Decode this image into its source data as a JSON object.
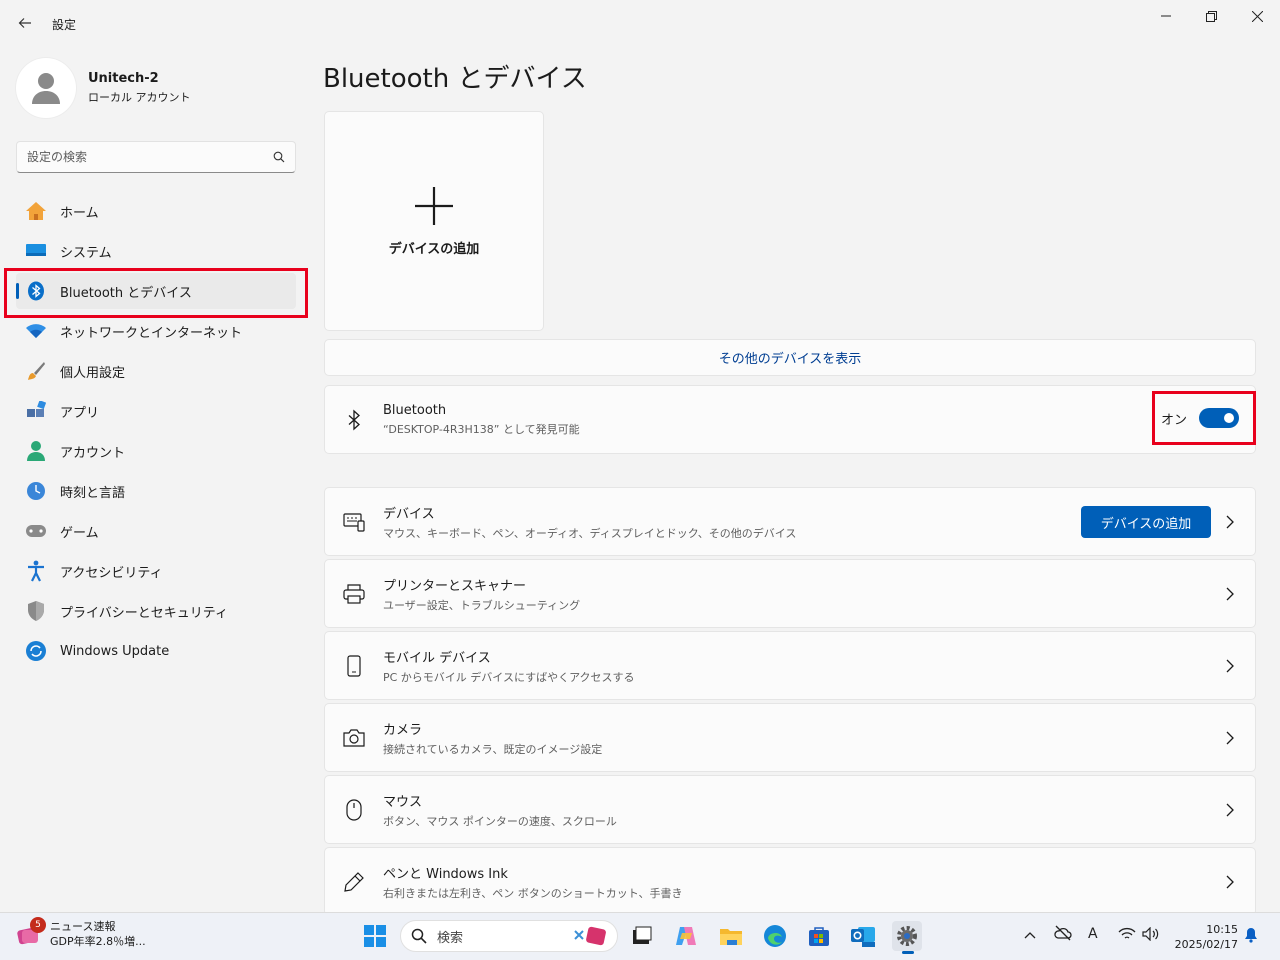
{
  "app": {
    "title": "設定"
  },
  "profile": {
    "name": "Unitech-2",
    "account_type": "ローカル アカウント"
  },
  "search": {
    "placeholder": "設定の検索"
  },
  "nav": {
    "items": [
      {
        "label": "ホーム",
        "icon": "home-icon"
      },
      {
        "label": "システム",
        "icon": "system-icon"
      },
      {
        "label": "Bluetooth とデバイス",
        "icon": "bluetooth-icon",
        "active": true
      },
      {
        "label": "ネットワークとインターネット",
        "icon": "wifi-icon"
      },
      {
        "label": "個人用設定",
        "icon": "brush-icon"
      },
      {
        "label": "アプリ",
        "icon": "apps-icon"
      },
      {
        "label": "アカウント",
        "icon": "account-icon"
      },
      {
        "label": "時刻と言語",
        "icon": "time-language-icon"
      },
      {
        "label": "ゲーム",
        "icon": "gamepad-icon"
      },
      {
        "label": "アクセシビリティ",
        "icon": "accessibility-icon"
      },
      {
        "label": "プライバシーとセキュリティ",
        "icon": "shield-icon"
      },
      {
        "label": "Windows Update",
        "icon": "windows-update-icon"
      }
    ]
  },
  "main": {
    "title": "Bluetooth とデバイス",
    "add_tile_label": "デバイスの追加",
    "more_devices_link": "その他のデバイスを表示",
    "bluetooth": {
      "title": "Bluetooth",
      "subtitle": "“DESKTOP-4R3H138” として発見可能",
      "toggle_label": "オン",
      "toggle_on": true
    },
    "cards": [
      {
        "title": "デバイス",
        "subtitle": "マウス、キーボード、ペン、オーディオ、ディスプレイとドック、その他のデバイス",
        "button": "デバイスの追加",
        "icon": "devices-icon"
      },
      {
        "title": "プリンターとスキャナー",
        "subtitle": "ユーザー設定、トラブルシューティング",
        "icon": "printer-icon"
      },
      {
        "title": "モバイル デバイス",
        "subtitle": "PC からモバイル デバイスにすばやくアクセスする",
        "icon": "mobile-icon"
      },
      {
        "title": "カメラ",
        "subtitle": "接続されているカメラ、既定のイメージ設定",
        "icon": "camera-icon"
      },
      {
        "title": "マウス",
        "subtitle": "ボタン、マウス ポインターの速度、スクロール",
        "icon": "mouse-icon"
      },
      {
        "title": "ペンと Windows Ink",
        "subtitle": "右利きまたは左利き、ペン ボタンのショートカット、手書き",
        "icon": "pen-icon"
      }
    ]
  },
  "taskbar": {
    "news_badge": "5",
    "news_title": "ニュース速報",
    "news_headline": "GDP年率2.8％増...",
    "search_label": "検索",
    "time": "10:15",
    "date": "2025/02/17",
    "ime": "A"
  },
  "colors": {
    "accent": "#005fb8",
    "highlight": "#e8001c"
  }
}
